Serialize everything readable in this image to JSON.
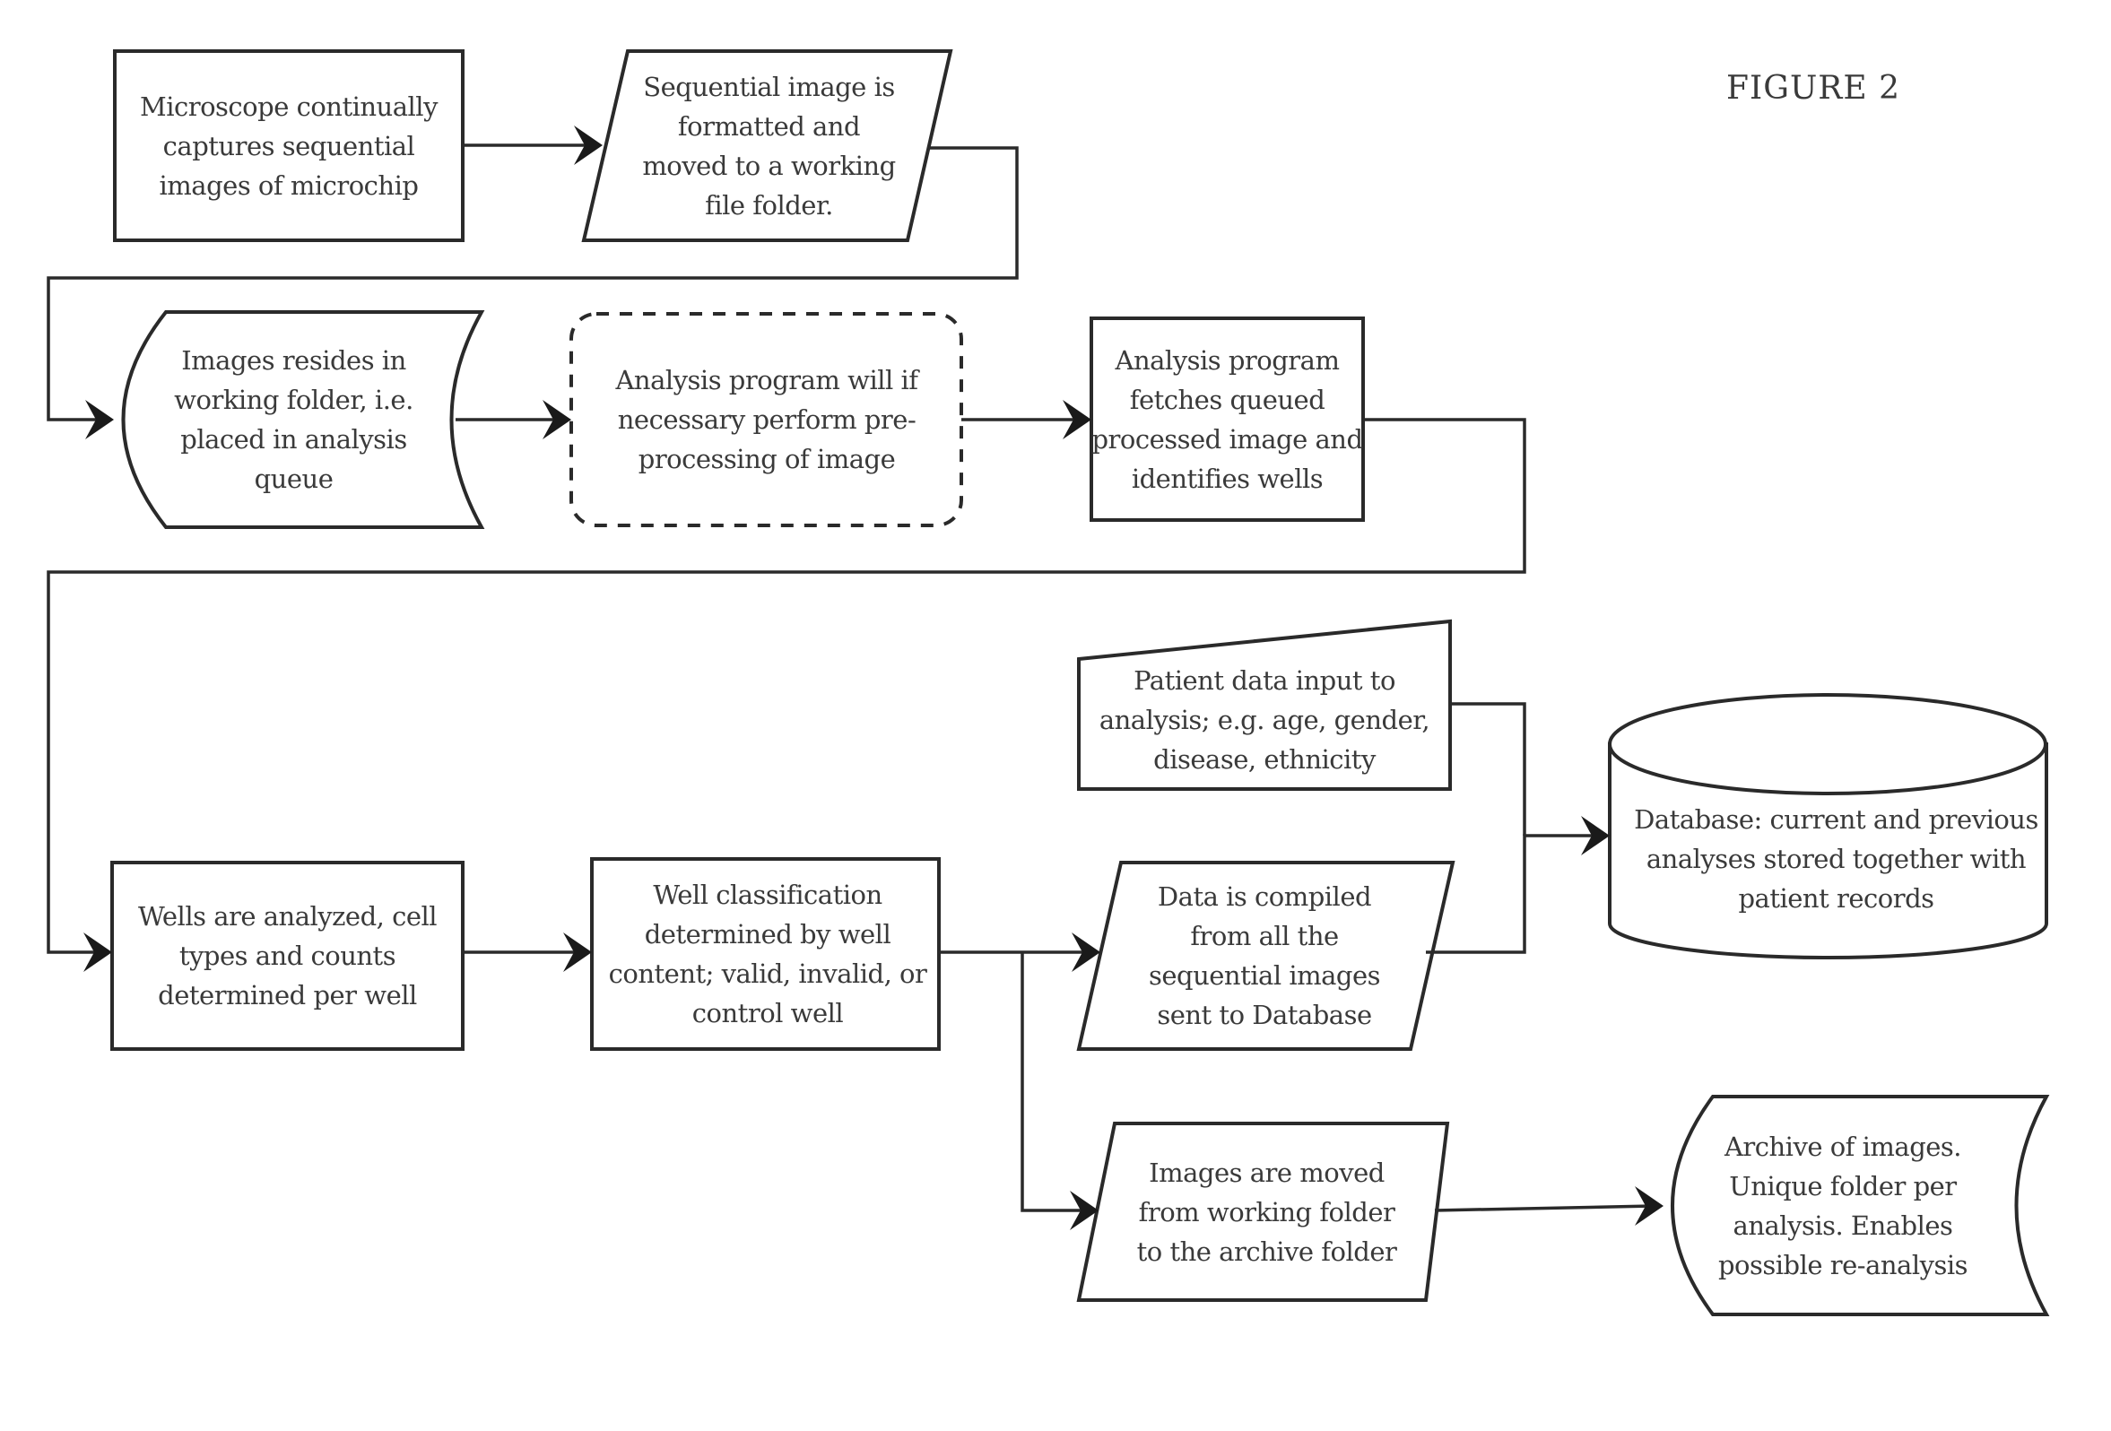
{
  "figure": {
    "title": "FIGURE 2"
  },
  "nodes": {
    "microscope": {
      "shape": "process",
      "text": "Microscope continually\ncaptures sequential\nimages of microchip"
    },
    "format_image": {
      "shape": "data-io",
      "text": "Sequential image is\nformatted and\nmoved to a working\nfile folder."
    },
    "working_folder": {
      "shape": "stored-data",
      "text": "Images resides in\nworking folder, i.e.\nplaced in analysis\nqueue"
    },
    "preprocess": {
      "shape": "optional-process-dashed",
      "text": "Analysis program will if\nnecessary perform pre-\nprocessing of image"
    },
    "fetch_identify": {
      "shape": "process",
      "text": "Analysis program\nfetches queued\nprocessed image and\nidentifies wells"
    },
    "analyze_wells": {
      "shape": "process",
      "text": "Wells are analyzed, cell\ntypes and counts\ndetermined per well"
    },
    "classify_wells": {
      "shape": "process",
      "text": "Well classification\ndetermined by well\ncontent; valid, invalid, or\ncontrol well"
    },
    "patient_data": {
      "shape": "manual-input",
      "text": "Patient data input to\nanalysis; e.g. age, gender,\ndisease, ethnicity"
    },
    "compile_data": {
      "shape": "data-io",
      "text": "Data is compiled\nfrom all the\nsequential images\nsent to Database"
    },
    "database": {
      "shape": "database",
      "text": "Database: current and previous\nanalyses stored together with\npatient records"
    },
    "move_images": {
      "shape": "data-io",
      "text": "Images are moved\nfrom working folder\nto the archive folder"
    },
    "archive": {
      "shape": "stored-data",
      "text": "Archive of images.\nUnique folder per\nanalysis. Enables\npossible re-analysis"
    }
  },
  "edges": [
    {
      "from": "microscope",
      "to": "format_image"
    },
    {
      "from": "format_image",
      "to": "working_folder"
    },
    {
      "from": "working_folder",
      "to": "preprocess"
    },
    {
      "from": "preprocess",
      "to": "fetch_identify"
    },
    {
      "from": "fetch_identify",
      "to": "analyze_wells"
    },
    {
      "from": "analyze_wells",
      "to": "classify_wells"
    },
    {
      "from": "classify_wells",
      "to": "compile_data"
    },
    {
      "from": "classify_wells",
      "to": "move_images"
    },
    {
      "from": "patient_data",
      "to": "database"
    },
    {
      "from": "compile_data",
      "to": "database"
    },
    {
      "from": "move_images",
      "to": "archive"
    }
  ]
}
